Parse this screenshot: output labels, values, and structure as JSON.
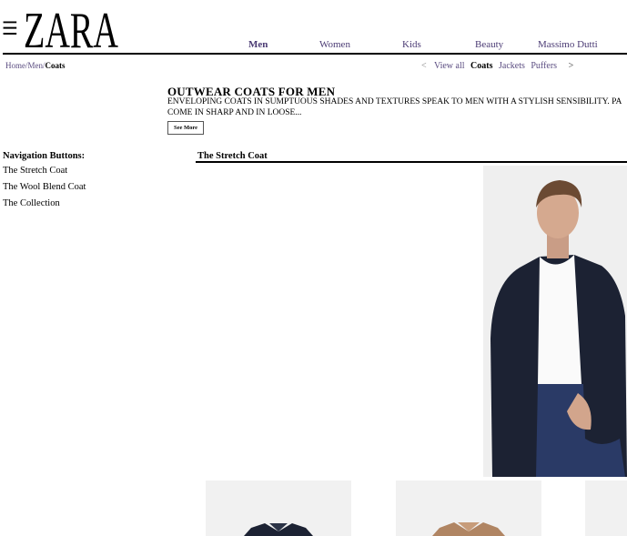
{
  "header": {
    "menu_icon": "hamburger-icon",
    "logo_text": "ZARA",
    "nav": [
      "Men",
      "Women",
      "Kids",
      "Beauty",
      "Massimo Dutti"
    ],
    "nav_active": "Men"
  },
  "breadcrumb": {
    "home": "Home",
    "men": "Men",
    "current": "Coats",
    "sep": "/"
  },
  "subnav": {
    "prev": "<",
    "items": [
      "View all",
      "Coats",
      "Jackets",
      "Puffers"
    ],
    "active": "Coats",
    "next": ">"
  },
  "intro": {
    "title": "OUTWEAR COATS FOR MEN",
    "line1": "ENVELOPING COATS IN SUMPTUOUS SHADES AND TEXTURES SPEAK TO MEN WITH A STYLISH SENSIBILITY. PA",
    "line2": "COME IN SHARP AND IN LOOSE...",
    "see_more": "See More"
  },
  "sidebar": {
    "label": "Navigation Buttons:",
    "items": [
      "The Stretch Coat",
      "The Wool Blend Coat",
      "The Collection"
    ]
  },
  "section": {
    "title": "The Stretch Coat"
  },
  "colors": {
    "nav_link": "#4b3b74",
    "crumb": "#5a4c80",
    "coat_navy": "#1c2233",
    "coat_camel": "#b08563"
  }
}
